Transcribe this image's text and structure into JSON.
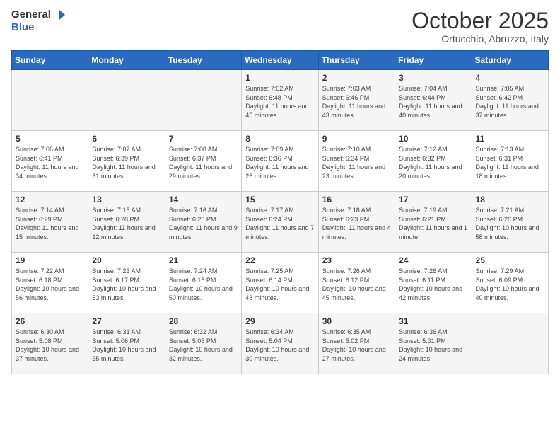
{
  "header": {
    "logo_line1": "General",
    "logo_line2": "Blue",
    "main_title": "October 2025",
    "subtitle": "Ortucchio, Abruzzo, Italy"
  },
  "days_of_week": [
    "Sunday",
    "Monday",
    "Tuesday",
    "Wednesday",
    "Thursday",
    "Friday",
    "Saturday"
  ],
  "weeks": [
    [
      {
        "day": "",
        "info": ""
      },
      {
        "day": "",
        "info": ""
      },
      {
        "day": "",
        "info": ""
      },
      {
        "day": "1",
        "info": "Sunrise: 7:02 AM\nSunset: 6:48 PM\nDaylight: 11 hours and 45 minutes."
      },
      {
        "day": "2",
        "info": "Sunrise: 7:03 AM\nSunset: 6:46 PM\nDaylight: 11 hours and 43 minutes."
      },
      {
        "day": "3",
        "info": "Sunrise: 7:04 AM\nSunset: 6:44 PM\nDaylight: 11 hours and 40 minutes."
      },
      {
        "day": "4",
        "info": "Sunrise: 7:05 AM\nSunset: 6:42 PM\nDaylight: 11 hours and 37 minutes."
      }
    ],
    [
      {
        "day": "5",
        "info": "Sunrise: 7:06 AM\nSunset: 6:41 PM\nDaylight: 11 hours and 34 minutes."
      },
      {
        "day": "6",
        "info": "Sunrise: 7:07 AM\nSunset: 6:39 PM\nDaylight: 11 hours and 31 minutes."
      },
      {
        "day": "7",
        "info": "Sunrise: 7:08 AM\nSunset: 6:37 PM\nDaylight: 11 hours and 29 minutes."
      },
      {
        "day": "8",
        "info": "Sunrise: 7:09 AM\nSunset: 6:36 PM\nDaylight: 11 hours and 26 minutes."
      },
      {
        "day": "9",
        "info": "Sunrise: 7:10 AM\nSunset: 6:34 PM\nDaylight: 11 hours and 23 minutes."
      },
      {
        "day": "10",
        "info": "Sunrise: 7:12 AM\nSunset: 6:32 PM\nDaylight: 11 hours and 20 minutes."
      },
      {
        "day": "11",
        "info": "Sunrise: 7:13 AM\nSunset: 6:31 PM\nDaylight: 11 hours and 18 minutes."
      }
    ],
    [
      {
        "day": "12",
        "info": "Sunrise: 7:14 AM\nSunset: 6:29 PM\nDaylight: 11 hours and 15 minutes."
      },
      {
        "day": "13",
        "info": "Sunrise: 7:15 AM\nSunset: 6:28 PM\nDaylight: 11 hours and 12 minutes."
      },
      {
        "day": "14",
        "info": "Sunrise: 7:16 AM\nSunset: 6:26 PM\nDaylight: 11 hours and 9 minutes."
      },
      {
        "day": "15",
        "info": "Sunrise: 7:17 AM\nSunset: 6:24 PM\nDaylight: 11 hours and 7 minutes."
      },
      {
        "day": "16",
        "info": "Sunrise: 7:18 AM\nSunset: 6:23 PM\nDaylight: 11 hours and 4 minutes."
      },
      {
        "day": "17",
        "info": "Sunrise: 7:19 AM\nSunset: 6:21 PM\nDaylight: 11 hours and 1 minute."
      },
      {
        "day": "18",
        "info": "Sunrise: 7:21 AM\nSunset: 6:20 PM\nDaylight: 10 hours and 58 minutes."
      }
    ],
    [
      {
        "day": "19",
        "info": "Sunrise: 7:22 AM\nSunset: 6:18 PM\nDaylight: 10 hours and 56 minutes."
      },
      {
        "day": "20",
        "info": "Sunrise: 7:23 AM\nSunset: 6:17 PM\nDaylight: 10 hours and 53 minutes."
      },
      {
        "day": "21",
        "info": "Sunrise: 7:24 AM\nSunset: 6:15 PM\nDaylight: 10 hours and 50 minutes."
      },
      {
        "day": "22",
        "info": "Sunrise: 7:25 AM\nSunset: 6:14 PM\nDaylight: 10 hours and 48 minutes."
      },
      {
        "day": "23",
        "info": "Sunrise: 7:26 AM\nSunset: 6:12 PM\nDaylight: 10 hours and 45 minutes."
      },
      {
        "day": "24",
        "info": "Sunrise: 7:28 AM\nSunset: 6:11 PM\nDaylight: 10 hours and 42 minutes."
      },
      {
        "day": "25",
        "info": "Sunrise: 7:29 AM\nSunset: 6:09 PM\nDaylight: 10 hours and 40 minutes."
      }
    ],
    [
      {
        "day": "26",
        "info": "Sunrise: 6:30 AM\nSunset: 5:08 PM\nDaylight: 10 hours and 37 minutes."
      },
      {
        "day": "27",
        "info": "Sunrise: 6:31 AM\nSunset: 5:06 PM\nDaylight: 10 hours and 35 minutes."
      },
      {
        "day": "28",
        "info": "Sunrise: 6:32 AM\nSunset: 5:05 PM\nDaylight: 10 hours and 32 minutes."
      },
      {
        "day": "29",
        "info": "Sunrise: 6:34 AM\nSunset: 5:04 PM\nDaylight: 10 hours and 30 minutes."
      },
      {
        "day": "30",
        "info": "Sunrise: 6:35 AM\nSunset: 5:02 PM\nDaylight: 10 hours and 27 minutes."
      },
      {
        "day": "31",
        "info": "Sunrise: 6:36 AM\nSunset: 5:01 PM\nDaylight: 10 hours and 24 minutes."
      },
      {
        "day": "",
        "info": ""
      }
    ]
  ]
}
